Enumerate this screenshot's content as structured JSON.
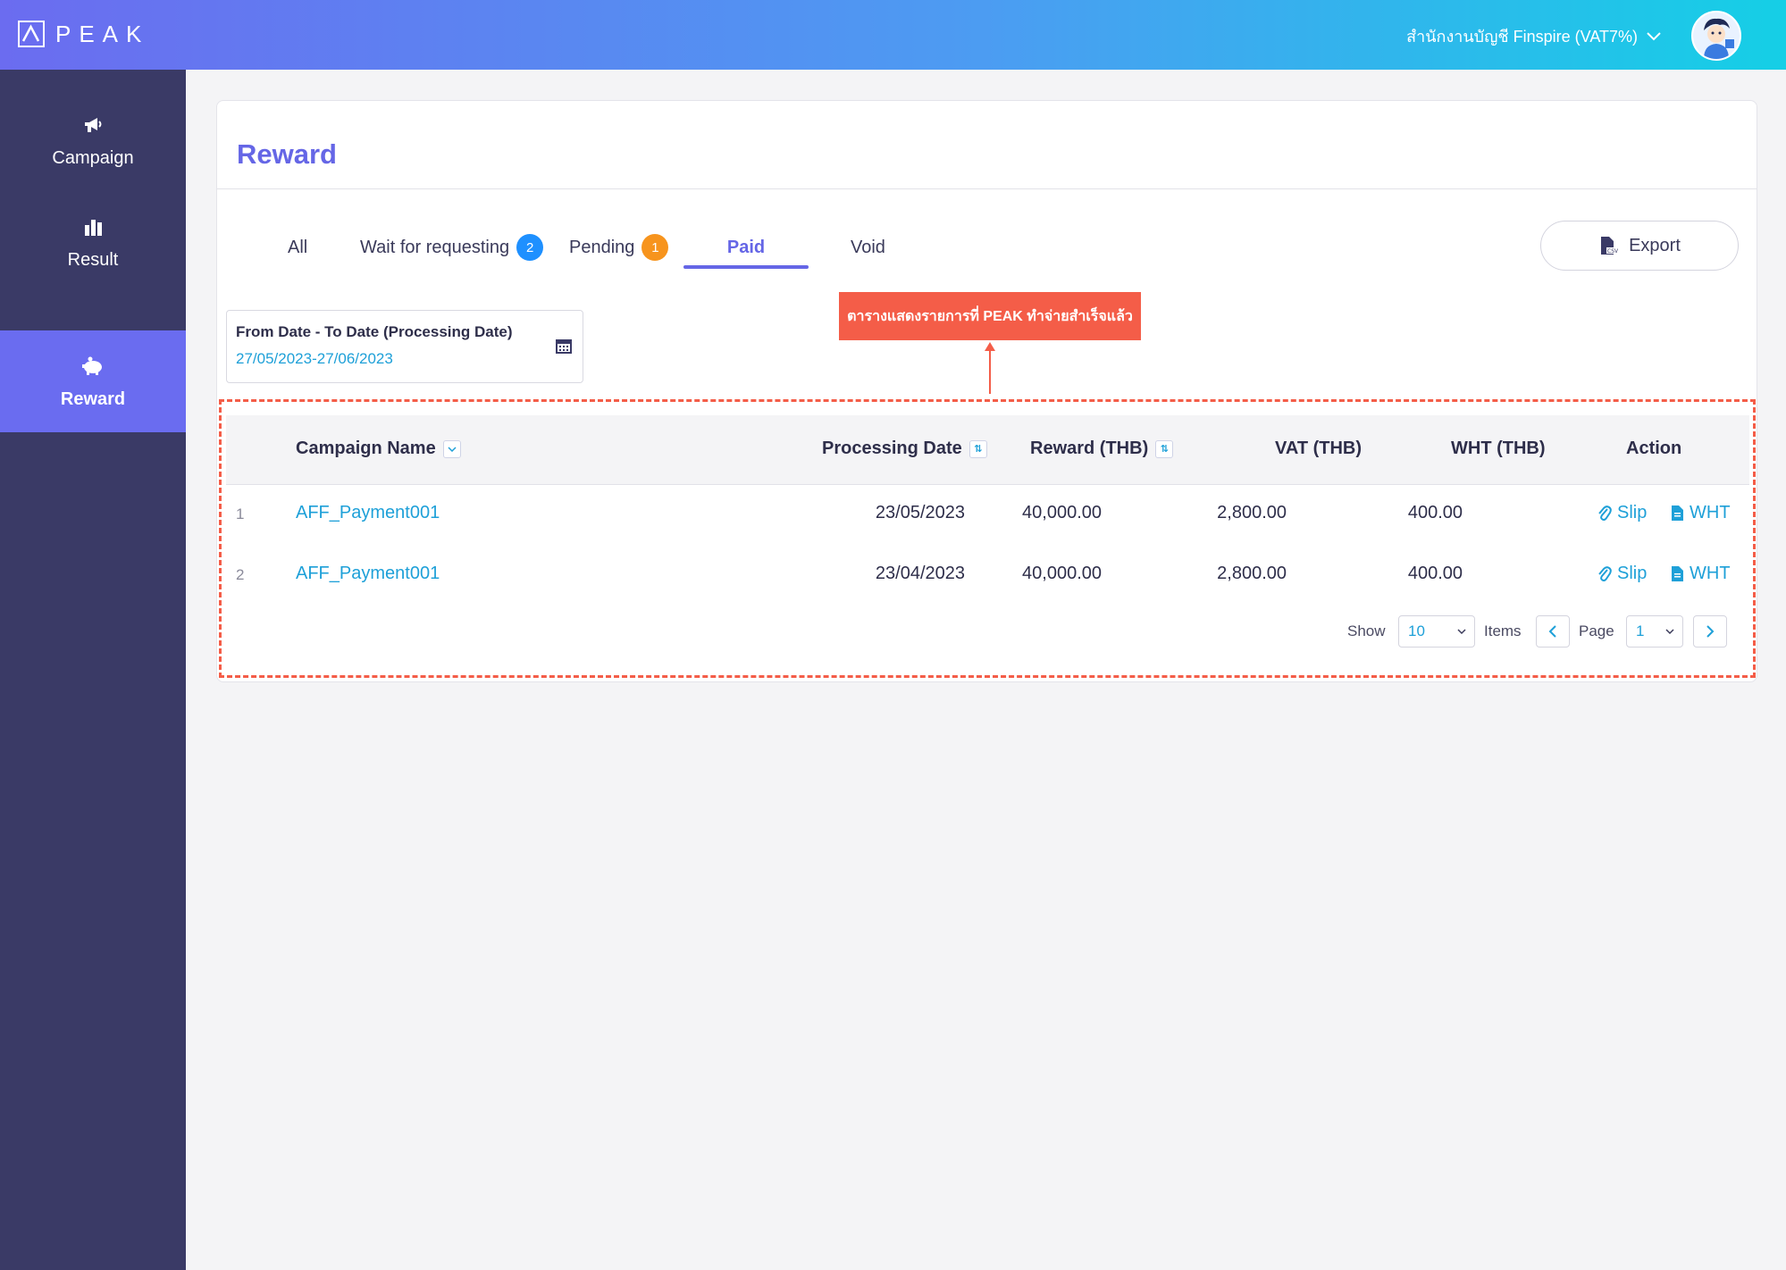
{
  "header": {
    "brand": "PEAK",
    "org_name": "สำนักงานบัญชี Finspire (VAT7%)"
  },
  "sidebar": {
    "items": [
      {
        "label": "Campaign",
        "icon": "megaphone-icon"
      },
      {
        "label": "Result",
        "icon": "bar-chart-icon"
      },
      {
        "label": "Reward",
        "icon": "piggy-bank-icon",
        "active": true
      }
    ]
  },
  "page": {
    "title": "Reward",
    "tabs": [
      {
        "label": "All"
      },
      {
        "label": "Wait for requesting",
        "badge": "2",
        "badge_color": "#1e90ff"
      },
      {
        "label": "Pending",
        "badge": "1",
        "badge_color": "#f7941d"
      },
      {
        "label": "Paid",
        "active": true
      },
      {
        "label": "Void"
      }
    ],
    "export_label": "Export",
    "date_filter": {
      "label": "From Date - To Date (Processing Date)",
      "value": "27/05/2023-27/06/2023"
    },
    "annotation": "ตารางแสดงรายการที่ PEAK ทำจ่ายสำเร็จแล้ว"
  },
  "table": {
    "columns": {
      "campaign": "Campaign Name",
      "processing_date": "Processing Date",
      "reward": "Reward (THB)",
      "vat": "VAT (THB)",
      "wht": "WHT (THB)",
      "action": "Action"
    },
    "rows": [
      {
        "no": "1",
        "campaign": "AFF_Payment001",
        "processing_date": "23/05/2023",
        "reward": "40,000.00",
        "vat": "2,800.00",
        "wht": "400.00",
        "slip": "Slip",
        "wht_doc": "WHT"
      },
      {
        "no": "2",
        "campaign": "AFF_Payment001",
        "processing_date": "23/04/2023",
        "reward": "40,000.00",
        "vat": "2,800.00",
        "wht": "400.00",
        "slip": "Slip",
        "wht_doc": "WHT"
      }
    ]
  },
  "pagination": {
    "show_label": "Show",
    "page_size": "10",
    "items_label": "Items",
    "page_label": "Page",
    "page": "1"
  },
  "colors": {
    "accent": "#6566e6",
    "link": "#1ea0d8",
    "sidebar": "#3a3a66",
    "annotation": "#f45d48"
  }
}
